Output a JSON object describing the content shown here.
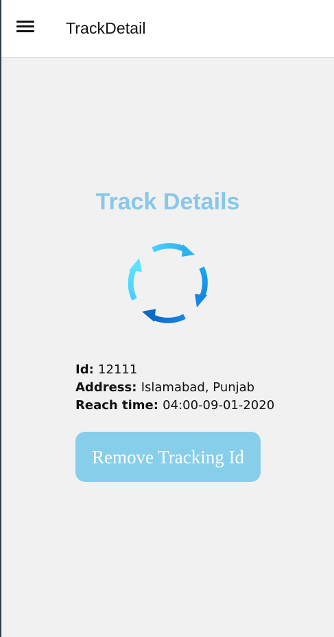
{
  "app_bar": {
    "title": "TrackDetail",
    "menu_icon": "hamburger-menu-icon"
  },
  "main": {
    "heading": "Track Details",
    "status_icon": "refresh-sync-icon",
    "details": {
      "id_label": "Id:",
      "id_value": "12111",
      "address_label": "Address:",
      "address_value": "Islamabad, Punjab",
      "reach_time_label": "Reach time:",
      "reach_time_value": "04:00-09-01-2020"
    },
    "remove_button_label": "Remove Tracking Id"
  },
  "colors": {
    "heading": "#87c8ea",
    "button_bg": "#87ceeb",
    "background": "#f1f1f1",
    "icon_light": "#4fd6ff",
    "icon_dark": "#0a72d0"
  }
}
